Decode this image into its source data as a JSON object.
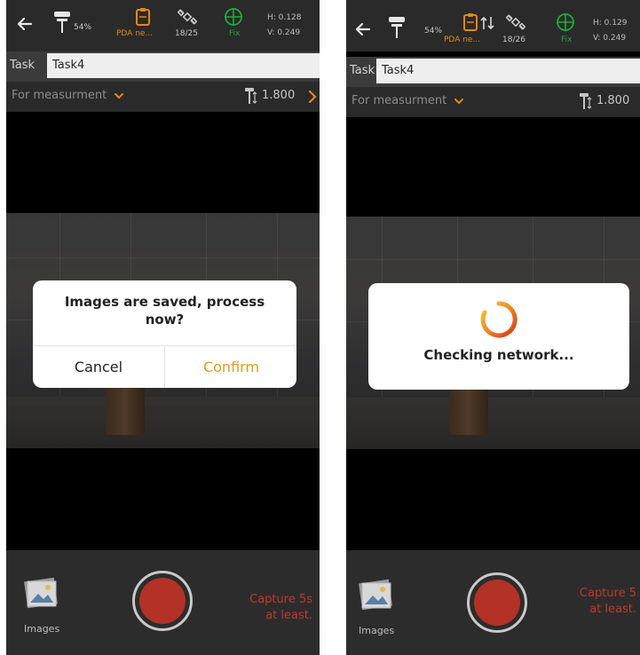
{
  "left": {
    "status": {
      "battery": "54%",
      "pda_label": "PDA ne...",
      "satellites": "18/25",
      "fix_label": "Fix",
      "h_precision": "H: 0.128",
      "v_precision": "V: 0.249"
    },
    "task": {
      "label": "Task",
      "value": "Task4"
    },
    "mode": {
      "label": "For measurment",
      "antenna_height": "1.800"
    },
    "dialog": {
      "message": "Images are saved, process now?",
      "cancel_label": "Cancel",
      "confirm_label": "Confirm"
    },
    "bottom": {
      "images_label": "Images",
      "hint_line1": "Capture 5s",
      "hint_line2": "at least."
    }
  },
  "right": {
    "status": {
      "battery": "54%",
      "pda_label": "PDA ne...",
      "satellites": "18/26",
      "fix_label": "Fix",
      "h_precision": "H: 0.129",
      "v_precision": "V: 0.249"
    },
    "task": {
      "label": "Task",
      "value": "Task4"
    },
    "mode": {
      "label": "For measurment",
      "antenna_height": "1.800"
    },
    "dialog": {
      "message": "Checking network..."
    },
    "bottom": {
      "images_label": "Images",
      "hint_line1": "Capture 5",
      "hint_line2": "at least."
    }
  },
  "icons": {
    "back": "arrow-left-icon",
    "pole": "gnss-pole-icon",
    "clipboard": "clipboard-icon",
    "data_arrows": "up-down-arrows-icon",
    "satellite": "satellite-icon",
    "fix": "crosshair-globe-icon",
    "chevron": "chevron-down-icon",
    "antenna_height": "antenna-height-icon",
    "images": "gallery-icon",
    "spinner": "loading-spinner-icon"
  },
  "colors": {
    "accent_orange": "#e08a15",
    "fix_green": "#22a83c",
    "capture_red": "#b33125",
    "hint_red": "#c0392b",
    "confirm_orange": "#e89a1f"
  }
}
